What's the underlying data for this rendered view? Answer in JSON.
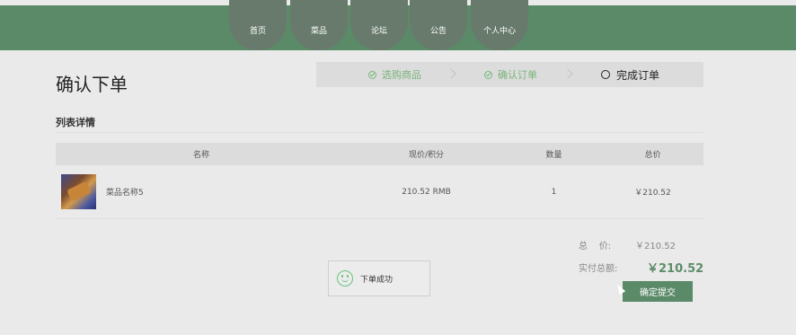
{
  "nav": {
    "items": [
      "首页",
      "菜品",
      "论坛",
      "公告",
      "个人中心"
    ]
  },
  "page": {
    "title": "确认下单"
  },
  "steps": [
    {
      "label": "选购商品",
      "status": "done"
    },
    {
      "label": "确认订单",
      "status": "done"
    },
    {
      "label": "完成订单",
      "status": "current"
    }
  ],
  "section": {
    "title": "列表详情"
  },
  "table": {
    "headers": [
      "名称",
      "现价/积分",
      "数量",
      "总价"
    ],
    "rows": [
      {
        "name": "菜品名称5",
        "price": "210.52 RMB",
        "quantity": "1",
        "total": "￥210.52"
      }
    ]
  },
  "summary": {
    "total_label": "总    价:",
    "total_value": "￥210.52",
    "actual_label": "实付总额:",
    "actual_value": "￥210.52"
  },
  "submit_label": "确定提交",
  "toast": {
    "message": "下单成功"
  },
  "colors": {
    "brand_green": "#5a8a68",
    "nav_tab": "#687a6c",
    "step_done": "#79b37a",
    "toast_icon": "#68c27b"
  }
}
